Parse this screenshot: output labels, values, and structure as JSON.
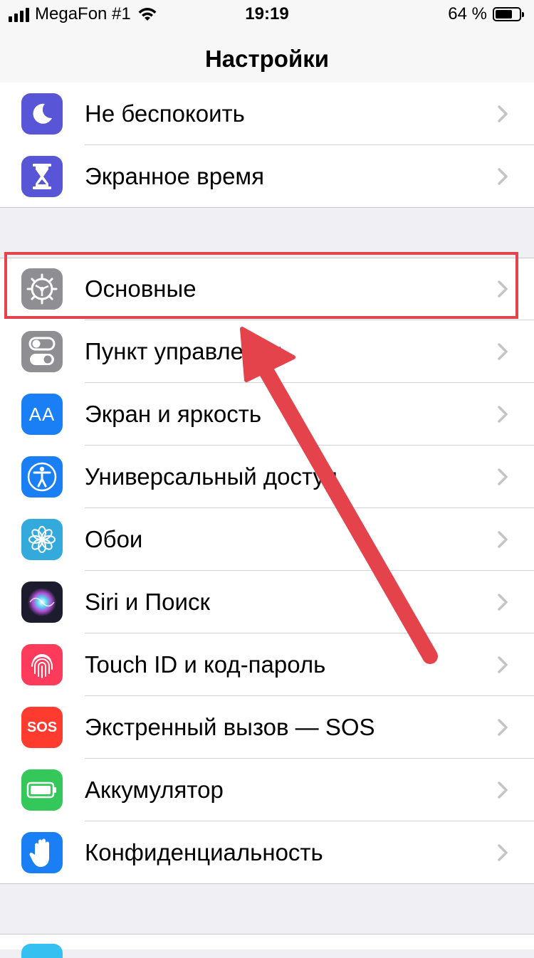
{
  "status_bar": {
    "carrier": "MegaFon #1",
    "time": "19:19",
    "battery": "64 %",
    "battery_level": 0.64
  },
  "nav": {
    "title": "Настройки"
  },
  "group1": [
    {
      "label": "Не беспокоить",
      "icon": "moon-icon",
      "color": "#5856d6"
    },
    {
      "label": "Экранное время",
      "icon": "hourglass-icon",
      "color": "#5856d6"
    }
  ],
  "group2": [
    {
      "label": "Основные",
      "icon": "gear-icon",
      "color": "#8e8e93"
    },
    {
      "label": "Пункт управления",
      "icon": "toggles-icon",
      "color": "#8e8e93"
    },
    {
      "label": "Экран и яркость",
      "icon": "text-size-icon",
      "color": "#1a7ff5",
      "icon_text": "AA"
    },
    {
      "label": "Универсальный доступ",
      "icon": "accessibility-icon",
      "color": "#1a7ff5"
    },
    {
      "label": "Обои",
      "icon": "flower-icon",
      "color": "#34aadc"
    },
    {
      "label": "Siri и Поиск",
      "icon": "siri-icon",
      "color": "#1c1c2e"
    },
    {
      "label": "Touch ID и код-пароль",
      "icon": "fingerprint-icon",
      "color": "#ff3b5c"
    },
    {
      "label": "Экстренный вызов — SOS",
      "icon": "sos-icon",
      "color": "#ff3b30",
      "icon_text": "SOS"
    },
    {
      "label": "Аккумулятор",
      "icon": "battery-icon",
      "color": "#34c759"
    },
    {
      "label": "Конфиденциальность",
      "icon": "hand-icon",
      "color": "#1a7ff5"
    }
  ],
  "annotation": {
    "highlight_color": "#e5434b"
  }
}
